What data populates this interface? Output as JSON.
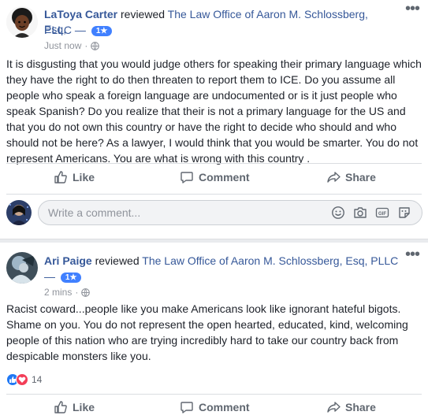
{
  "review1": {
    "reviewer": "LaToya Carter",
    "verb": "reviewed",
    "page": "The Law Office of Aaron M. Schlossberg, Esq,",
    "page_line2": "PLLC",
    "dash": "—",
    "rating": "1★",
    "time": "Just now",
    "text": "It is disgusting that you would judge others for speaking their primary language which they have the right to do then threaten to report them to ICE. Do you assume all people who speak a foreign language are undocumented or is it just people who speak Spanish? Do you realize that their is not a primary language for the US and that you do not own this country or have the right to decide who should and who should not be here? As a lawyer, I would think that you would be smarter. You do not represent Americans. You are what is wrong with this country .",
    "like": "Like",
    "comment": "Comment",
    "share": "Share",
    "comment_placeholder": "Write a comment..."
  },
  "review2": {
    "reviewer": "Ari Paige",
    "verb": "reviewed",
    "page": "The Law Office of Aaron M. Schlossberg, Esq, PLLC",
    "dash": "—",
    "rating": "1★",
    "time": "2 mins",
    "text": "Racist coward...people like you make Americans look like ignorant hateful bigots. Shame on you. You do not represent the open hearted, educated, kind, welcoming people of this nation who are trying incredibly hard to take our country back from despicable monsters like you.",
    "reaction_count": "14",
    "like": "Like",
    "comment": "Comment",
    "share": "Share"
  },
  "colors": {
    "link": "#365899",
    "badge": "#4080ff",
    "muted": "#606770"
  },
  "icons": [
    "more-icon",
    "globe-icon",
    "like-icon",
    "comment-icon",
    "share-icon",
    "emoji-icon",
    "camera-icon",
    "gif-icon",
    "sticker-icon",
    "like-reaction-icon",
    "love-reaction-icon"
  ]
}
